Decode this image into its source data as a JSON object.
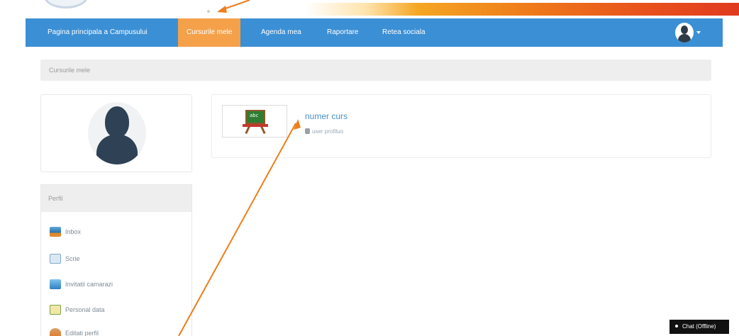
{
  "nav": {
    "items": [
      {
        "label": "Pagina principala a Campusului",
        "active": false
      },
      {
        "label": "Cursurile mele",
        "active": true
      },
      {
        "label": "Agenda mea",
        "active": false
      },
      {
        "label": "Raportare",
        "active": false
      },
      {
        "label": "Retea sociala",
        "active": false
      }
    ],
    "user_menu_icon": "user-avatar-icon",
    "colors": {
      "bar": "#3b8fd4",
      "active": "#f5a14a"
    }
  },
  "breadcrumb": {
    "label": "Cursurile mele"
  },
  "course": {
    "title": "numer curs",
    "profile_link": "user profiluo",
    "thumbnail_icon": "chalkboard-icon",
    "thumbnail_text": "abc"
  },
  "profile": {
    "avatar_icon": "user-silhouette-icon"
  },
  "perfil": {
    "title": "Perfil",
    "items": [
      {
        "label": "Inbox",
        "icon": "inbox-icon"
      },
      {
        "label": "Scrie",
        "icon": "compose-icon"
      },
      {
        "label": "Invitatii camarazi",
        "icon": "invitations-icon"
      },
      {
        "label": "Personal data",
        "icon": "personal-data-icon"
      },
      {
        "label": "Editati perfil",
        "icon": "edit-profile-icon"
      }
    ]
  },
  "chat": {
    "label": "Chat (Offline)"
  },
  "annotation_color": "#ef7d1a"
}
